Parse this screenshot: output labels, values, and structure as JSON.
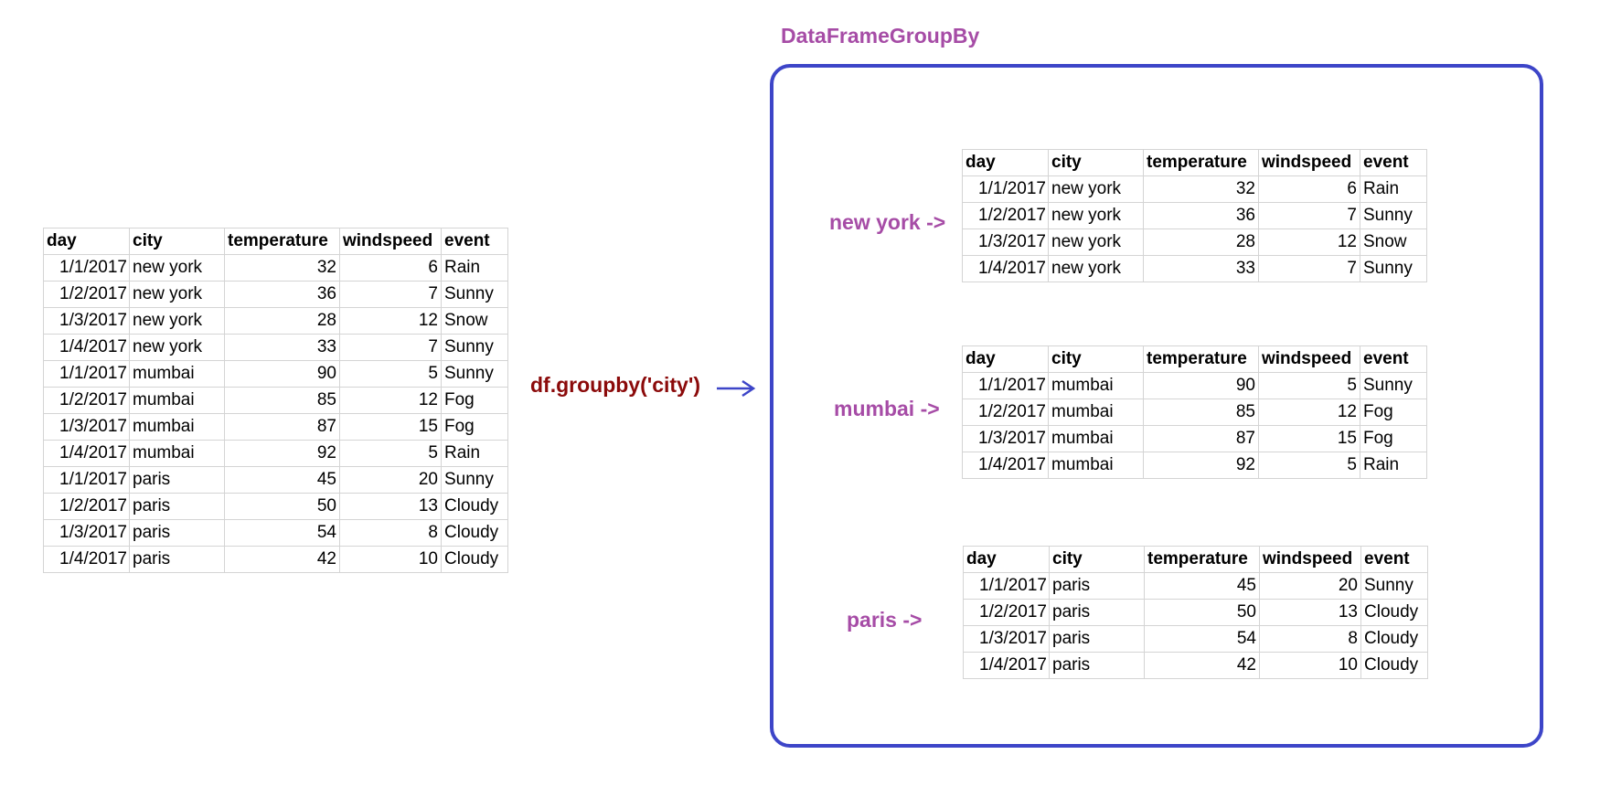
{
  "columns": [
    "day",
    "city",
    "temperature",
    "windspeed",
    "event"
  ],
  "source_rows": [
    [
      "1/1/2017",
      "new york",
      "32",
      "6",
      "Rain"
    ],
    [
      "1/2/2017",
      "new york",
      "36",
      "7",
      "Sunny"
    ],
    [
      "1/3/2017",
      "new york",
      "28",
      "12",
      "Snow"
    ],
    [
      "1/4/2017",
      "new york",
      "33",
      "7",
      "Sunny"
    ],
    [
      "1/1/2017",
      "mumbai",
      "90",
      "5",
      "Sunny"
    ],
    [
      "1/2/2017",
      "mumbai",
      "85",
      "12",
      "Fog"
    ],
    [
      "1/3/2017",
      "mumbai",
      "87",
      "15",
      "Fog"
    ],
    [
      "1/4/2017",
      "mumbai",
      "92",
      "5",
      "Rain"
    ],
    [
      "1/1/2017",
      "paris",
      "45",
      "20",
      "Sunny"
    ],
    [
      "1/2/2017",
      "paris",
      "50",
      "13",
      "Cloudy"
    ],
    [
      "1/3/2017",
      "paris",
      "54",
      "8",
      "Cloudy"
    ],
    [
      "1/4/2017",
      "paris",
      "42",
      "10",
      "Cloudy"
    ]
  ],
  "operation_label": "df.groupby('city')",
  "groupby_title": "DataFrameGroupBy",
  "groups": [
    {
      "label": "new york ->",
      "rows": [
        [
          "1/1/2017",
          "new york",
          "32",
          "6",
          "Rain"
        ],
        [
          "1/2/2017",
          "new york",
          "36",
          "7",
          "Sunny"
        ],
        [
          "1/3/2017",
          "new york",
          "28",
          "12",
          "Snow"
        ],
        [
          "1/4/2017",
          "new york",
          "33",
          "7",
          "Sunny"
        ]
      ]
    },
    {
      "label": "mumbai ->",
      "rows": [
        [
          "1/1/2017",
          "mumbai",
          "90",
          "5",
          "Sunny"
        ],
        [
          "1/2/2017",
          "mumbai",
          "85",
          "12",
          "Fog"
        ],
        [
          "1/3/2017",
          "mumbai",
          "87",
          "15",
          "Fog"
        ],
        [
          "1/4/2017",
          "mumbai",
          "92",
          "5",
          "Rain"
        ]
      ]
    },
    {
      "label": "paris ->",
      "rows": [
        [
          "1/1/2017",
          "paris",
          "45",
          "20",
          "Sunny"
        ],
        [
          "1/2/2017",
          "paris",
          "50",
          "13",
          "Cloudy"
        ],
        [
          "1/3/2017",
          "paris",
          "54",
          "8",
          "Cloudy"
        ],
        [
          "1/4/2017",
          "paris",
          "42",
          "10",
          "Cloudy"
        ]
      ]
    }
  ],
  "colors": {
    "label_purple": "#a64ca6",
    "operation_dark_red": "#8b0a0a",
    "arrow_and_box_blue": "#3d45c8",
    "grid_lines": "#d4d4d4"
  }
}
